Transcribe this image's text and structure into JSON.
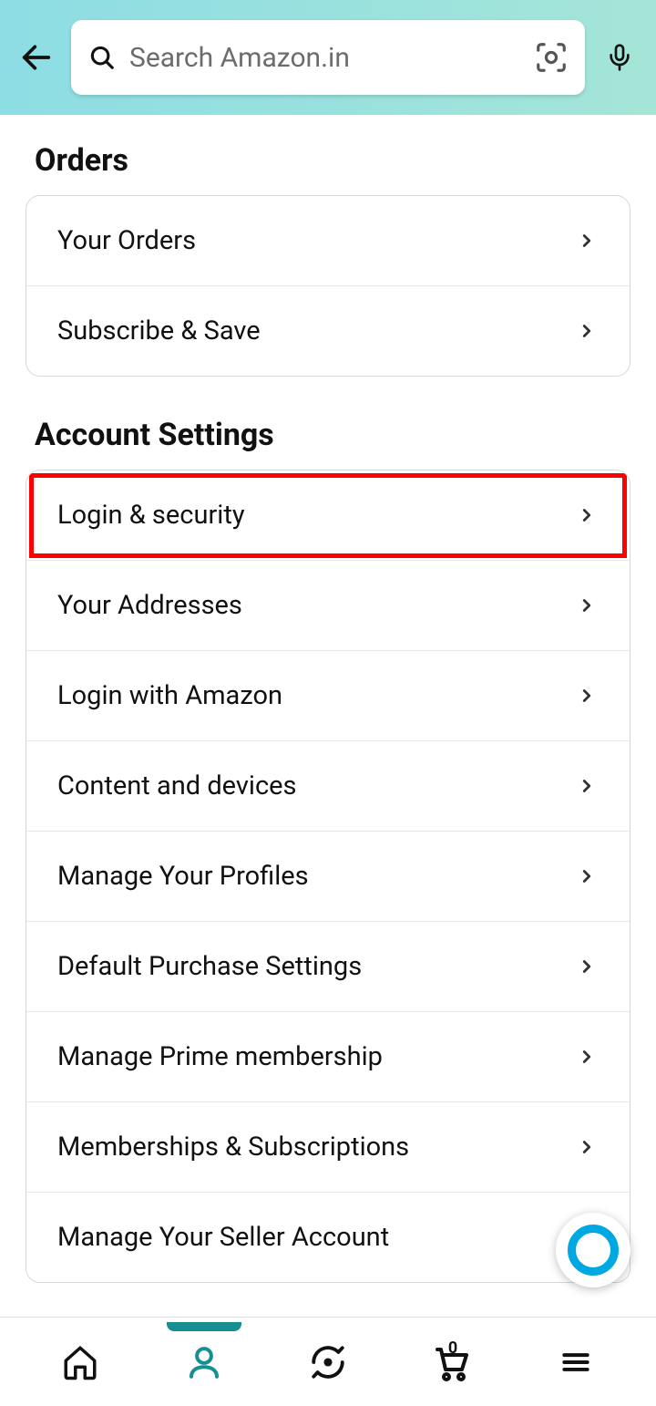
{
  "search": {
    "placeholder": "Search Amazon.in"
  },
  "sections": {
    "orders": {
      "title": "Orders",
      "items": [
        {
          "label": "Your Orders"
        },
        {
          "label": "Subscribe & Save"
        }
      ]
    },
    "account": {
      "title": "Account Settings",
      "items": [
        {
          "label": "Login & security"
        },
        {
          "label": "Your Addresses"
        },
        {
          "label": "Login with Amazon"
        },
        {
          "label": "Content and devices"
        },
        {
          "label": "Manage Your Profiles"
        },
        {
          "label": "Default Purchase Settings"
        },
        {
          "label": "Manage Prime membership"
        },
        {
          "label": "Memberships & Subscriptions"
        },
        {
          "label": "Manage Your Seller Account"
        }
      ]
    }
  },
  "cart": {
    "count": "0"
  }
}
